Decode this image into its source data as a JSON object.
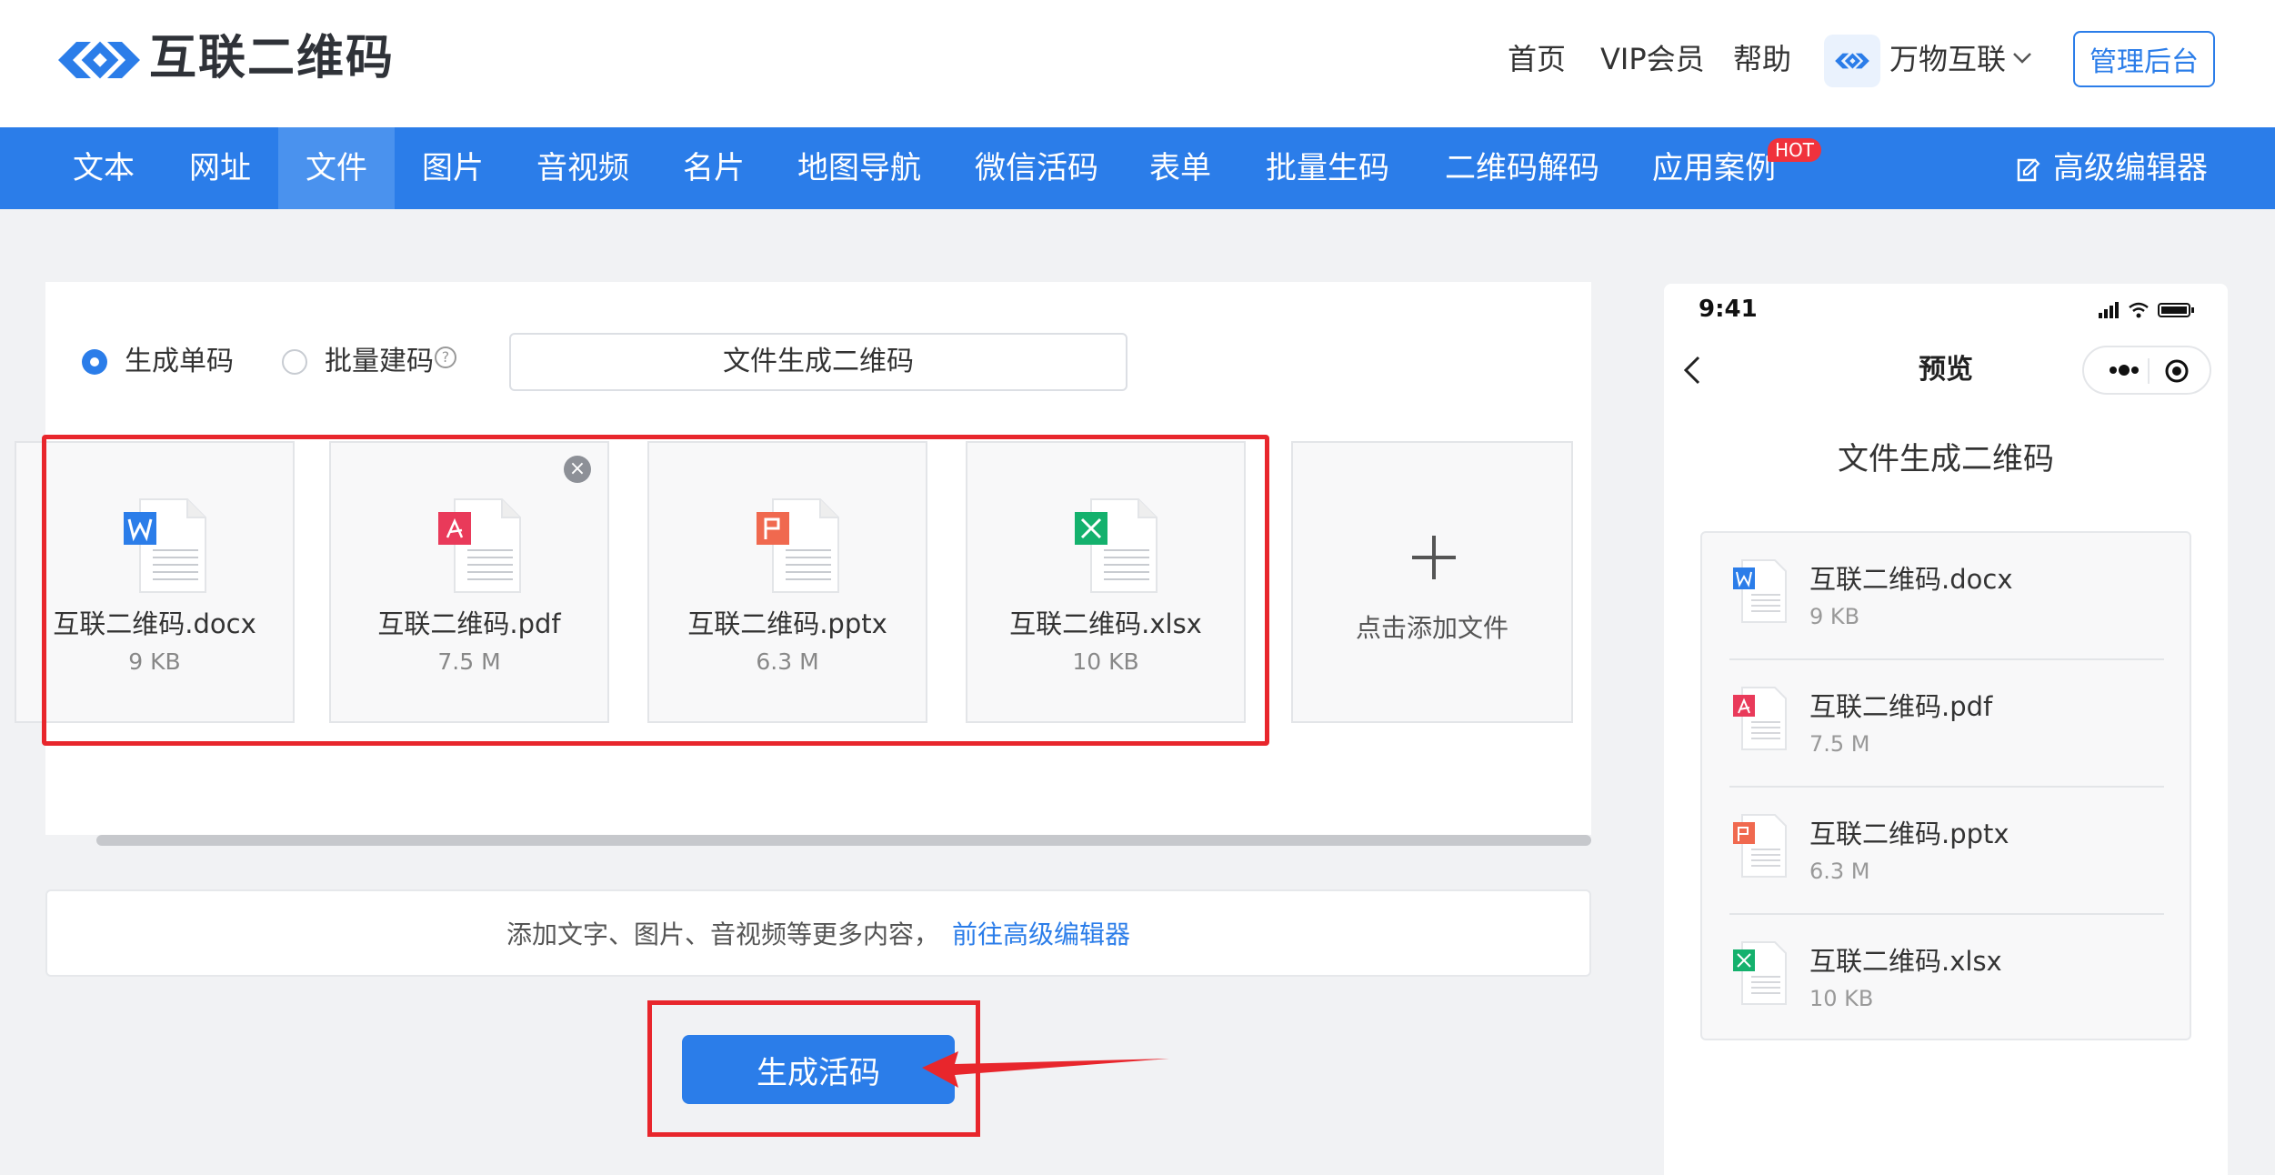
{
  "header": {
    "logo_text": "互联二维码",
    "links": [
      "首页",
      "VIP会员",
      "帮助"
    ],
    "brand_name": "万物互联",
    "admin_button": "管理后台"
  },
  "nav": {
    "items": [
      "文本",
      "网址",
      "文件",
      "图片",
      "音视频",
      "名片",
      "地图导航",
      "微信活码",
      "表单",
      "批量生码",
      "二维码解码",
      "应用案例"
    ],
    "active": "文件",
    "hot_badge": "HOT",
    "advanced_editor": "高级编辑器"
  },
  "mode": {
    "single": "生成单码",
    "batch": "批量建码",
    "selected": "single"
  },
  "title_input": {
    "value": "文件生成二维码"
  },
  "files": [
    {
      "name": "互联二维码.docx",
      "size": "9 KB",
      "type": "word",
      "color": "#2b7de9"
    },
    {
      "name": "互联二维码.pdf",
      "size": "7.5 M",
      "type": "pdf",
      "color": "#e93a5a"
    },
    {
      "name": "互联二维码.pptx",
      "size": "6.3 M",
      "type": "ppt",
      "color": "#f0694f"
    },
    {
      "name": "互联二维码.xlsx",
      "size": "10 KB",
      "type": "excel",
      "color": "#14b16d"
    }
  ],
  "add_file_label": "点击添加文件",
  "more": {
    "text": "添加文字、图片、音视频等更多内容，",
    "link": "前往高级编辑器"
  },
  "generate_button": "生成活码",
  "phone": {
    "time": "9:41",
    "title": "预览",
    "heading": "文件生成二维码"
  },
  "colors": {
    "primary": "#2b7de9",
    "highlight": "#e8262c",
    "hot": "#f0323c"
  }
}
